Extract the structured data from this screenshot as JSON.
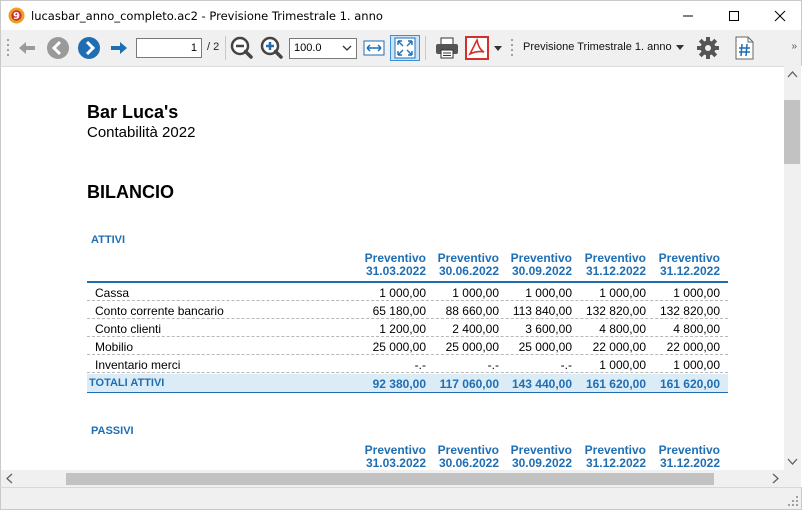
{
  "window": {
    "title": "lucasbar_anno_completo.ac2 - Previsione Trimestrale 1. anno",
    "app_icon_label": "9"
  },
  "toolbar": {
    "page_current": "1",
    "page_total": "/ 2",
    "zoom": "100.0",
    "report_name": "Previsione Trimestrale 1. anno",
    "overflow": "»"
  },
  "report": {
    "company": "Bar Luca's",
    "subtitle": "Contabilità 2022",
    "title": "BILANCIO",
    "columns": [
      {
        "line1": "Preventivo",
        "line2": "31.03.2022"
      },
      {
        "line1": "Preventivo",
        "line2": "30.06.2022"
      },
      {
        "line1": "Preventivo",
        "line2": "30.09.2022"
      },
      {
        "line1": "Preventivo",
        "line2": "31.12.2022"
      },
      {
        "line1": "Preventivo",
        "line2": "31.12.2022"
      }
    ],
    "assets": {
      "heading": "ATTIVI",
      "rows": [
        {
          "label": "Cassa",
          "values": [
            "1 000,00",
            "1 000,00",
            "1 000,00",
            "1 000,00",
            "1 000,00"
          ]
        },
        {
          "label": "Conto corrente bancario",
          "values": [
            "65 180,00",
            "88 660,00",
            "113 840,00",
            "132 820,00",
            "132 820,00"
          ]
        },
        {
          "label": "Conto clienti",
          "values": [
            "1 200,00",
            "2 400,00",
            "3 600,00",
            "4 800,00",
            "4 800,00"
          ]
        },
        {
          "label": "Mobilio",
          "values": [
            "25 000,00",
            "25 000,00",
            "25 000,00",
            "22 000,00",
            "22 000,00"
          ]
        },
        {
          "label": "Inventario merci",
          "values": [
            "-.-",
            "-.-",
            "-.-",
            "1 000,00",
            "1 000,00"
          ]
        }
      ],
      "total": {
        "label": "TOTALI ATTIVI",
        "values": [
          "92 380,00",
          "117 060,00",
          "143 440,00",
          "161 620,00",
          "161 620,00"
        ]
      }
    },
    "liabilities": {
      "heading": "PASSIVI"
    }
  },
  "colors": {
    "accent": "#1f6eb4",
    "total_row_bg": "#dcecf6",
    "nav_circle": "#1f6eb4",
    "pdf_red": "#d0312d"
  }
}
